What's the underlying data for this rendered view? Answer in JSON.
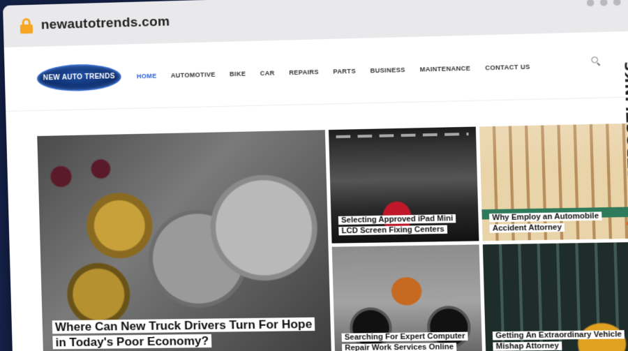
{
  "browser": {
    "url": "newautotrends.com"
  },
  "site": {
    "logo_text": "NEW AUTO TRENDS",
    "nav": [
      {
        "label": "HOME",
        "active": true
      },
      {
        "label": "AUTOMOTIVE"
      },
      {
        "label": "BIKE"
      },
      {
        "label": "CAR"
      },
      {
        "label": "REPAIRS"
      },
      {
        "label": "PARTS"
      },
      {
        "label": "BUSINESS"
      },
      {
        "label": "MAINTENANCE"
      },
      {
        "label": "CONTACT US"
      }
    ],
    "accent_color": "#2d5fd8"
  },
  "articles": [
    {
      "title": "Where Can New Truck Drivers Turn For Hope in Today's Poor Economy?",
      "image": "gears"
    },
    {
      "title": "Selecting Approved iPad Mini LCD Screen Fixing Centers",
      "image": "garage"
    },
    {
      "title": "Why Employ an Automobile Accident Attorney",
      "image": "building"
    },
    {
      "title": "Searching For Expert Computer Repair Work Services Online",
      "image": "motorbike"
    },
    {
      "title": "Getting An Extraordinary Vehicle Mishap Attorney",
      "image": "street"
    }
  ],
  "watermark": {
    "text": "GUESTPOSTLINKS",
    "color": "#e95b2b"
  }
}
